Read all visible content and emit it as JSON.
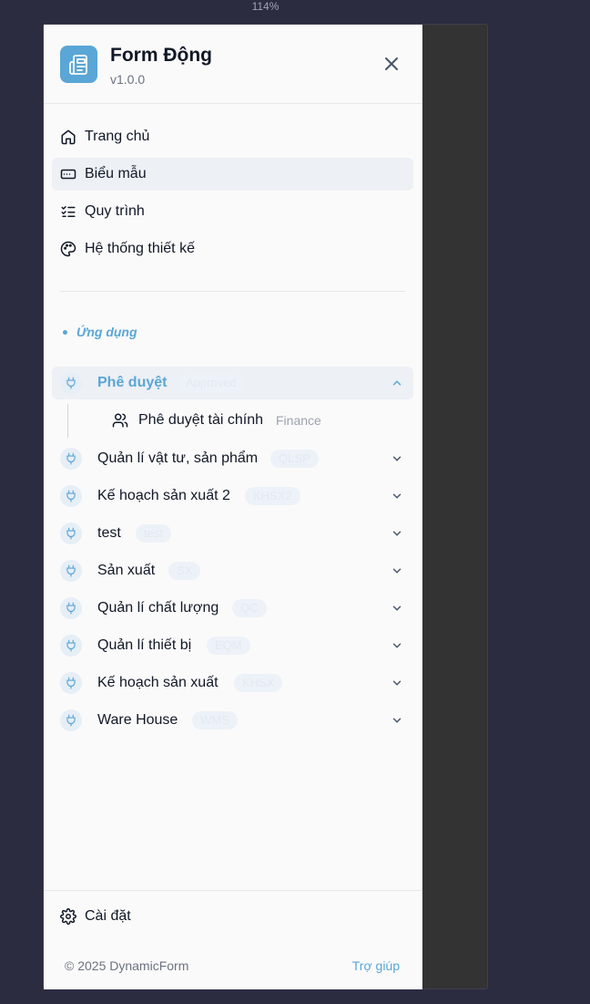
{
  "zoom": "114%",
  "header": {
    "title": "Form Động",
    "version": "v1.0.0",
    "logo_icon": "newspaper-icon",
    "close_icon": "close-icon"
  },
  "nav": [
    {
      "label": "Trang chủ",
      "icon": "home-icon",
      "active": false
    },
    {
      "label": "Biểu mẫu",
      "icon": "form-field-icon",
      "active": true
    },
    {
      "label": "Quy trình",
      "icon": "checklist-icon",
      "active": false
    },
    {
      "label": "Hệ thống thiết kế",
      "icon": "palette-icon",
      "active": false
    }
  ],
  "section_title": "Ứng dụng",
  "apps": [
    {
      "name": "Phê duyệt",
      "code": "Approved",
      "expanded": true,
      "children": [
        {
          "name": "Phê duyệt tài chính",
          "tag": "Finance",
          "icon": "users-icon"
        }
      ]
    },
    {
      "name": "Quản lí vật tư, sản phẩm",
      "code": "QLSP",
      "expanded": false
    },
    {
      "name": "Kế hoạch sản xuất 2",
      "code": "KHSX2",
      "expanded": false
    },
    {
      "name": "test",
      "code": "test",
      "expanded": false
    },
    {
      "name": "Sản xuất",
      "code": "SX",
      "expanded": false
    },
    {
      "name": "Quản lí chất lượng",
      "code": "QC",
      "expanded": false
    },
    {
      "name": "Quản lí thiết bị",
      "code": "EQM",
      "expanded": false
    },
    {
      "name": "Kế hoạch sản xuất",
      "code": "KHSX",
      "expanded": false
    },
    {
      "name": "Ware House",
      "code": "WMS",
      "expanded": false
    }
  ],
  "footer": {
    "settings_label": "Cài đặt",
    "copyright": "© 2025 DynamicForm",
    "help_label": "Trợ giúp"
  },
  "colors": {
    "accent": "#5aa6d6",
    "panel": "#fafafa",
    "backdrop": "#2c2c40"
  }
}
